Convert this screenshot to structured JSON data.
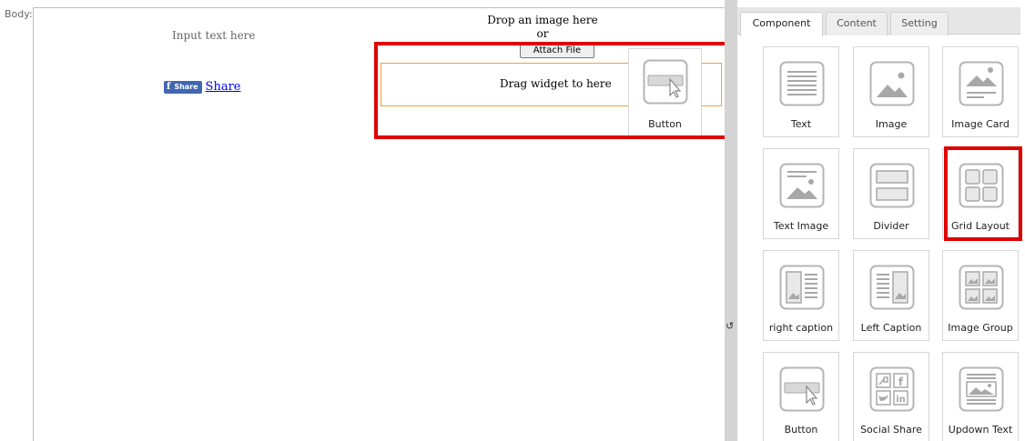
{
  "body_label": "Body:",
  "editor": {
    "input_text": "Input text here",
    "facebook_share_button": "Share",
    "facebook_share_glyph": "f",
    "share_link": "Share",
    "drop_line1": "Drop an image here",
    "drop_line2": "or",
    "attach_file": "Attach File",
    "drag_widget": "Drag widget to here",
    "dragging_widget_label": "Button"
  },
  "panel": {
    "tabs": [
      {
        "label": "Component",
        "active": true
      },
      {
        "label": "Content",
        "active": false
      },
      {
        "label": "Setting",
        "active": false
      }
    ],
    "widgets": [
      {
        "label": "Text",
        "icon": "text-icon"
      },
      {
        "label": "Image",
        "icon": "image-icon"
      },
      {
        "label": "Image Card",
        "icon": "image-card-icon"
      },
      {
        "label": "Text Image",
        "icon": "text-image-icon"
      },
      {
        "label": "Divider",
        "icon": "divider-icon"
      },
      {
        "label": "Grid Layout",
        "icon": "grid-layout-icon"
      },
      {
        "label": "right caption",
        "icon": "right-caption-icon"
      },
      {
        "label": "Left Caption",
        "icon": "left-caption-icon"
      },
      {
        "label": "Image Group",
        "icon": "image-group-icon"
      },
      {
        "label": "Button",
        "icon": "button-icon"
      },
      {
        "label": "Social Share",
        "icon": "social-share-icon"
      },
      {
        "label": "Updown Text",
        "icon": "updown-text-icon"
      }
    ]
  },
  "colors": {
    "highlight": "#e00000",
    "drop_border": "#e8a33c",
    "facebook": "#4267b2",
    "link": "#0000ee"
  }
}
